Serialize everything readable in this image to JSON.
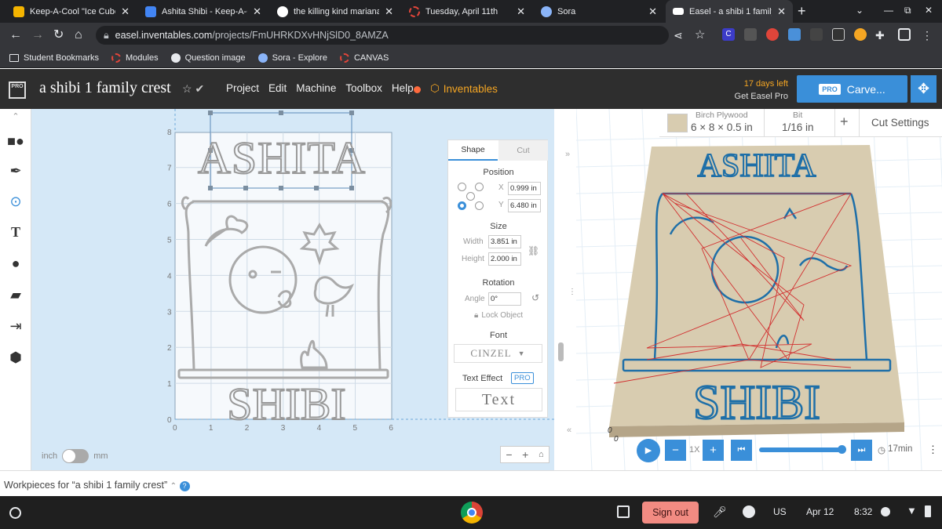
{
  "browser": {
    "tabs": [
      {
        "title": "Keep-A-Cool \"Ice Cube\"",
        "fav_color": "#f4b400"
      },
      {
        "title": "Ashita Shibi - Keep-A-C",
        "fav_color": "#4285f4"
      },
      {
        "title": "the killing kind mariana",
        "fav_color": "#ffffff"
      },
      {
        "title": "Tuesday, April 11th",
        "fav_color": "#e0453a"
      },
      {
        "title": "Sora",
        "fav_color": "#8ab4f8"
      },
      {
        "title": "Easel - a shibi 1 family",
        "fav_color": "#ffffff"
      }
    ],
    "url_host": "easel.inventables.com",
    "url_path": "/projects/FmUHRKDXvHNjSlD0_8AMZA",
    "bookmarks": [
      "Student Bookmarks",
      "Modules",
      "Question image",
      "Sora - Explore",
      "CANVAS"
    ]
  },
  "app": {
    "pro_badge": "PRO",
    "project_title": "a shibi 1 family crest",
    "menu": [
      "Project",
      "Edit",
      "Machine",
      "Toolbox",
      "Help"
    ],
    "inventables": "Inventables",
    "trial_days": "17 days left",
    "trial_cta": "Get Easel Pro",
    "carve_pro": "PRO",
    "carve_label": "Carve..."
  },
  "design": {
    "top_text": "ASHITA",
    "bottom_text": "SHIBI",
    "x_ticks": [
      "0",
      "1",
      "2",
      "3",
      "4",
      "5",
      "6"
    ],
    "y_ticks": [
      "8",
      "7",
      "6",
      "5",
      "4",
      "3",
      "2",
      "1",
      "0"
    ],
    "unit_left": "inch",
    "unit_right": "mm"
  },
  "inspector": {
    "tab_shape": "Shape",
    "tab_cut": "Cut",
    "position_label": "Position",
    "x_label": "X",
    "x_value": "0.999 in",
    "y_label": "Y",
    "y_value": "6.480 in",
    "size_label": "Size",
    "width_label": "Width",
    "width_value": "3.851 in",
    "height_label": "Height",
    "height_value": "2.000 in",
    "rotation_label": "Rotation",
    "angle_label": "Angle",
    "angle_value": "0°",
    "lock_label": "Lock Object",
    "font_label": "Font",
    "font_value": "CINZEL",
    "text_effect_label": "Text Effect",
    "text_effect_pro": "PRO",
    "text_effect_value": "Text"
  },
  "preview": {
    "material_name": "Birch Plywood",
    "material_size": "6 × 8 × 0.5 in",
    "bit_label": "Bit",
    "bit_value": "1/16 in",
    "cut_settings": "Cut Settings",
    "speed": "1X",
    "time": "17min",
    "origin": "0"
  },
  "footer": {
    "workpieces": "Workpieces for “a shibi 1 family crest”"
  },
  "shelf": {
    "sign_out": "Sign out",
    "lang": "US",
    "date": "Apr 12",
    "time": "8:32"
  }
}
